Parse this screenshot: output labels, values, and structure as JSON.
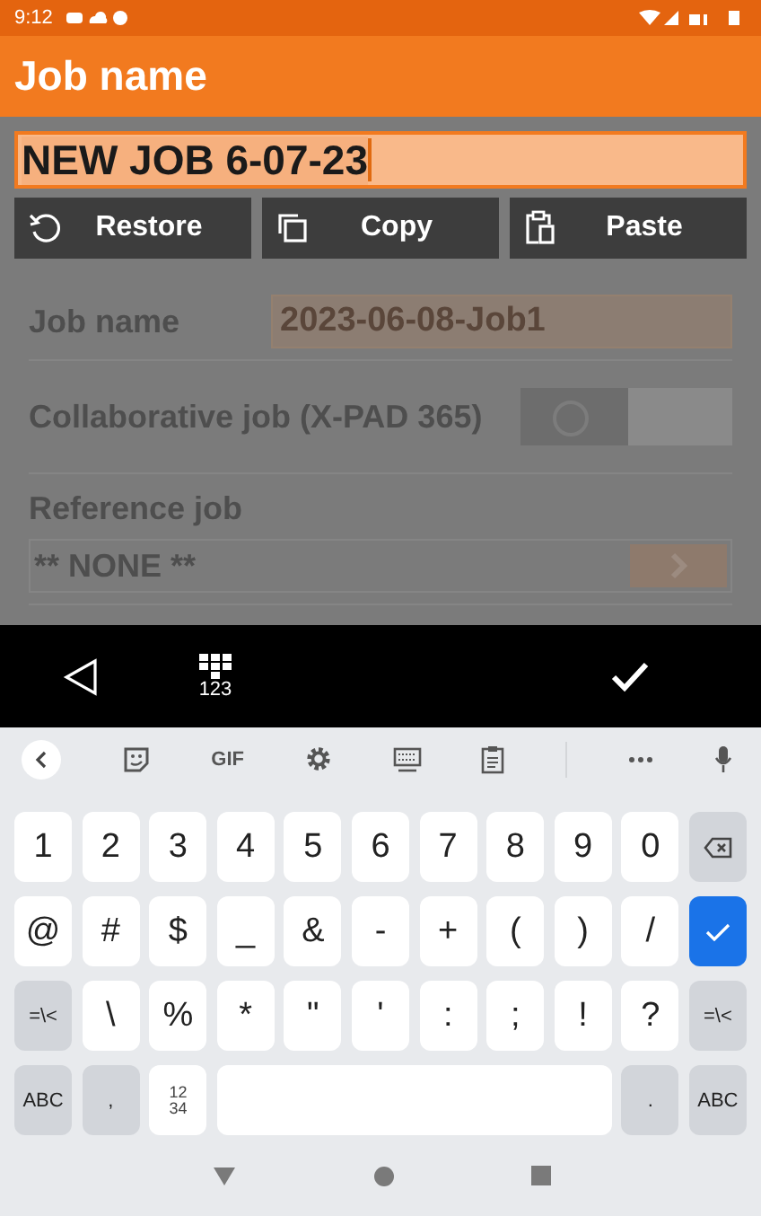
{
  "status_bar": {
    "time": "9:12"
  },
  "app_bar": {
    "title": "Job name"
  },
  "edit_field": {
    "value": "NEW JOB 6-07-23"
  },
  "edit_actions": [
    {
      "kind": "restore",
      "label": "Restore"
    },
    {
      "kind": "copy",
      "label": "Copy"
    },
    {
      "kind": "paste",
      "label": "Paste"
    }
  ],
  "form_rows": [
    {
      "kind": "text",
      "label": "Job name",
      "value": "2023-06-08-Job1"
    },
    {
      "kind": "toggle",
      "label": "Collaborative job (X-PAD 365)",
      "on": false
    },
    {
      "kind": "select",
      "label": "Reference job",
      "value": "** NONE **"
    }
  ],
  "input_toolbar": {
    "mode_label": "123"
  },
  "suggestion_strip": {
    "gif_label": "GIF"
  },
  "keys": [
    [
      {
        "kind": "char",
        "label": "1"
      },
      {
        "kind": "char",
        "label": "2"
      },
      {
        "kind": "char",
        "label": "3"
      },
      {
        "kind": "char",
        "label": "4"
      },
      {
        "kind": "char",
        "label": "5"
      },
      {
        "kind": "char",
        "label": "6"
      },
      {
        "kind": "char",
        "label": "7"
      },
      {
        "kind": "char",
        "label": "8"
      },
      {
        "kind": "char",
        "label": "9"
      },
      {
        "kind": "char",
        "label": "0"
      },
      {
        "kind": "backspace"
      }
    ],
    [
      {
        "kind": "char",
        "label": "@"
      },
      {
        "kind": "char",
        "label": "#"
      },
      {
        "kind": "char",
        "label": "$"
      },
      {
        "kind": "char",
        "label": "_"
      },
      {
        "kind": "char",
        "label": "&"
      },
      {
        "kind": "char",
        "label": "-"
      },
      {
        "kind": "char",
        "label": "+"
      },
      {
        "kind": "char",
        "label": "("
      },
      {
        "kind": "char",
        "label": ")"
      },
      {
        "kind": "char",
        "label": "/"
      },
      {
        "kind": "enter"
      }
    ],
    [
      {
        "kind": "function",
        "label": "=\\<"
      },
      {
        "kind": "char",
        "label": "\\"
      },
      {
        "kind": "char",
        "label": "%"
      },
      {
        "kind": "char",
        "label": "*"
      },
      {
        "kind": "char",
        "label": "\""
      },
      {
        "kind": "char",
        "label": "'"
      },
      {
        "kind": "char",
        "label": ":"
      },
      {
        "kind": "char",
        "label": ";"
      },
      {
        "kind": "char",
        "label": "!"
      },
      {
        "kind": "char",
        "label": "?"
      },
      {
        "kind": "function",
        "label": "=\\<"
      }
    ],
    [
      {
        "kind": "function",
        "label": "ABC"
      },
      {
        "kind": "function",
        "label": ","
      },
      {
        "kind": "numpad",
        "lines": [
          "12",
          "34"
        ]
      },
      {
        "kind": "space"
      },
      {
        "kind": "function",
        "label": "."
      },
      {
        "kind": "function",
        "label": "ABC"
      }
    ]
  ]
}
